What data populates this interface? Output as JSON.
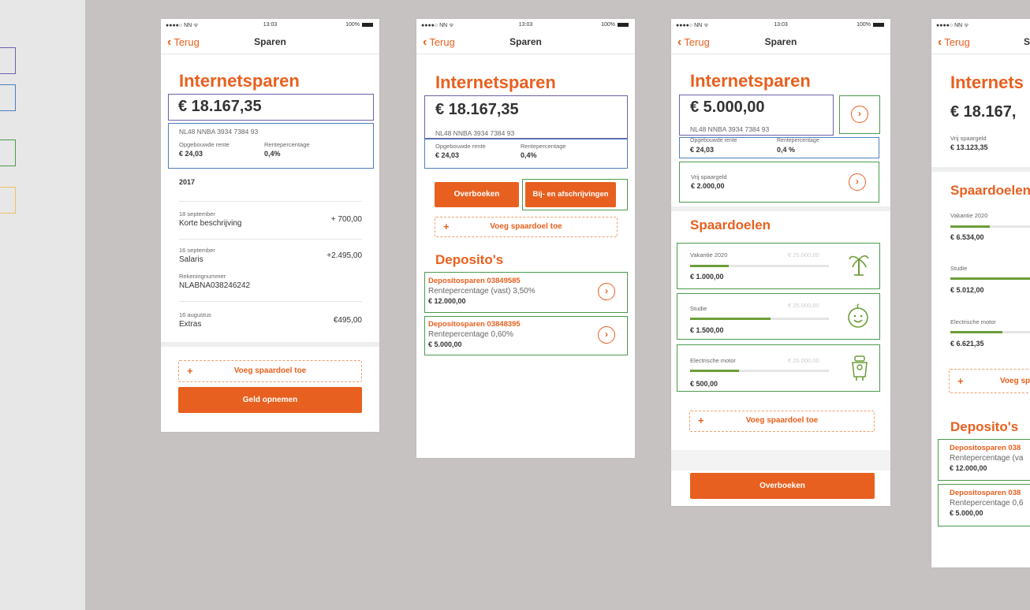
{
  "status": {
    "carrier": "●●●●○ NN ᯤ",
    "time": "13:03",
    "battery": "100%"
  },
  "nav": {
    "back": "Terug",
    "title": "Sparen"
  },
  "account": {
    "title": "Internetsparen",
    "balance": "€ 18.167,35",
    "balance_alt": "€ 5.000,00",
    "iban": "NL48 NNBA 3934 7384 93",
    "interest_label": "Opgebouwde rente",
    "interest_value": "€ 24,03",
    "rate_label": "Rentepercentage",
    "rate_value": "0,4%",
    "rate_value_spaced": "0,4 %"
  },
  "transactions": {
    "year": "2017",
    "items": [
      {
        "date": "18 september",
        "desc": "Korte beschrijving",
        "amount": "+ 700,00"
      },
      {
        "date": "16 september",
        "desc": "Salaris",
        "amount": "+2.495,00",
        "extra_label": "Rekeningnummer",
        "extra_value": "NLABNA038246242"
      },
      {
        "date": "16 augustus",
        "desc": "Extras",
        "amount": "€495,00"
      }
    ]
  },
  "actions": {
    "add_goal": "Voeg spaardoel toe",
    "withdraw": "Geld opnemen",
    "transfer": "Overboeken",
    "history": "Bij- en afschrijvingen",
    "plus": "+"
  },
  "free": {
    "label": "Vrij spaargeld",
    "value": "€ 2.000,00",
    "value_alt": "€ 13.123,35"
  },
  "goals": {
    "title": "Spaardoelen",
    "items": [
      {
        "name": "Vakantie 2020",
        "target": "€ 25.000,00",
        "value": "€ 1.000,00",
        "value_alt": "€ 6.534,00",
        "progress": 0.28,
        "progress_alt": 0.42,
        "icon": "palm-tree-icon"
      },
      {
        "name": "Studie",
        "target": "€ 25.000,00",
        "value": "€ 1.500,00",
        "value_alt": "€ 5.012,00",
        "progress": 0.58,
        "progress_alt": 0.9,
        "icon": "baby-face-icon"
      },
      {
        "name": "Electrische motor",
        "target": "€ 25.000,00",
        "value": "€ 500,00",
        "value_alt": "€ 6.621,35",
        "progress": 0.35,
        "progress_alt": 0.55,
        "icon": "scooter-icon"
      }
    ]
  },
  "deposits": {
    "title": "Deposito's",
    "items": [
      {
        "title": "Depositosparen 03849585",
        "title_cut": "Depositosparen 038",
        "rate": "Rentepercentage (vast) 3,50%",
        "rate_cut": "Rentepercentage (va",
        "value": "€ 12.000,00"
      },
      {
        "title": "Depositosparen 03848395",
        "title_cut": "Depositosparen 038",
        "rate": "Rentepercentage 0,60%",
        "rate_cut": "Rentepercentage 0,6",
        "value": "€ 5.000,00"
      }
    ]
  },
  "fourth": {
    "title_cut": "Internets",
    "balance_cut": "€ 18.167,",
    "nav_title_cut": "S",
    "goals_title_cut": "Spaardoelen",
    "add_goal_cut": "Voeg sp"
  },
  "colors": {
    "accent": "#e8601f",
    "purple": "#6a62a8",
    "blue": "#4d7fc0",
    "green": "#4b9a4c",
    "yellow": "#f0c060",
    "progress": "#6c9d3a"
  }
}
